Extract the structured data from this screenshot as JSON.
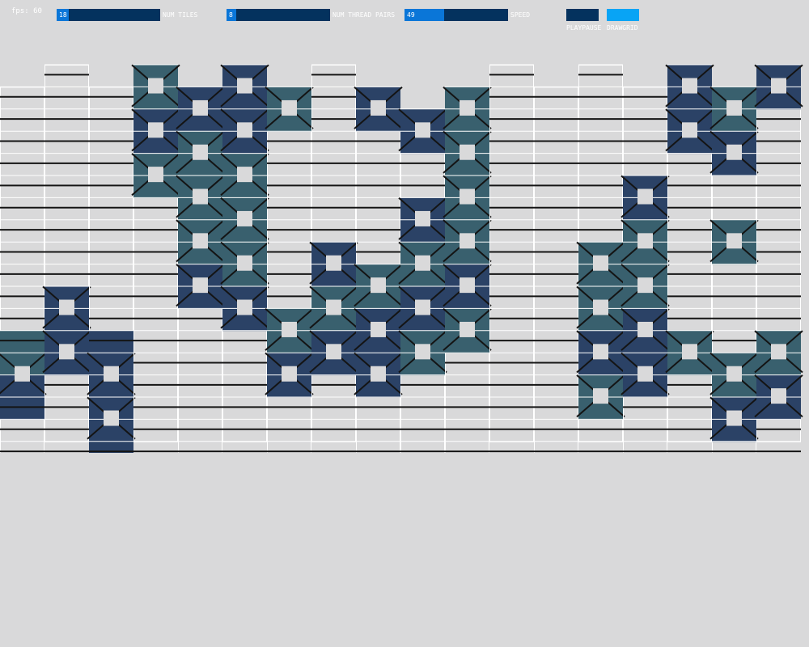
{
  "fps": "fps: 60",
  "sliders": {
    "num_tiles": {
      "value": "18",
      "label": "NUM TILES",
      "fraction": 0.12
    },
    "num_thread_pairs": {
      "value": "8",
      "label": "NUM THREAD PAIRS",
      "fraction": 0.09
    },
    "speed": {
      "value": "49",
      "label": "SPEED",
      "fraction": 0.38
    }
  },
  "buttons": {
    "playpause": {
      "label": "PLAYPAUSE",
      "color": "#04325e"
    },
    "drawgrid": {
      "label": "DRAWGRID",
      "color": "#08a4f5"
    }
  },
  "colors": {
    "background": "#d9d9da",
    "tile_dark": "#2b4266",
    "tile_teal": "#39606e",
    "thread": "#141414",
    "grid_line": "#ffffff"
  },
  "columns": [
    {
      "offset": 1,
      "tiles": [
        {
          "pos": 11,
          "shade": "teal"
        },
        {
          "pos": 12,
          "shade": "teal"
        },
        {
          "pos": 13,
          "shade": "dark"
        },
        {
          "pos": 14,
          "shade": "dark"
        }
      ]
    },
    {
      "offset": 0,
      "tiles": [
        {
          "pos": 10,
          "shade": "dark"
        },
        {
          "pos": 11,
          "shade": "dark"
        },
        {
          "pos": 12,
          "shade": "dark"
        },
        {
          "pos": 13,
          "shade": "dark"
        }
      ]
    },
    {
      "offset": 1,
      "tiles": [
        {
          "pos": 11,
          "shade": "dark"
        },
        {
          "pos": 12,
          "shade": "dark"
        },
        {
          "pos": 13,
          "shade": "dark"
        },
        {
          "pos": 14,
          "shade": "dark"
        },
        {
          "pos": 15,
          "shade": "dark"
        },
        {
          "pos": 16,
          "shade": "dark"
        }
      ]
    },
    {
      "offset": 0,
      "tiles": [
        {
          "pos": 0,
          "shade": "teal"
        },
        {
          "pos": 1,
          "shade": "teal"
        },
        {
          "pos": 2,
          "shade": "dark"
        },
        {
          "pos": 3,
          "shade": "dark"
        },
        {
          "pos": 4,
          "shade": "teal"
        },
        {
          "pos": 5,
          "shade": "teal"
        }
      ]
    },
    {
      "offset": 1,
      "tiles": [
        {
          "pos": 0,
          "shade": "dark"
        },
        {
          "pos": 1,
          "shade": "dark"
        },
        {
          "pos": 2,
          "shade": "teal"
        },
        {
          "pos": 3,
          "shade": "teal"
        },
        {
          "pos": 4,
          "shade": "teal"
        },
        {
          "pos": 5,
          "shade": "teal"
        },
        {
          "pos": 6,
          "shade": "teal"
        },
        {
          "pos": 7,
          "shade": "teal"
        },
        {
          "pos": 8,
          "shade": "dark"
        },
        {
          "pos": 9,
          "shade": "dark"
        }
      ]
    },
    {
      "offset": 0,
      "tiles": [
        {
          "pos": 0,
          "shade": "dark"
        },
        {
          "pos": 1,
          "shade": "dark"
        },
        {
          "pos": 2,
          "shade": "dark"
        },
        {
          "pos": 3,
          "shade": "dark"
        },
        {
          "pos": 4,
          "shade": "teal"
        },
        {
          "pos": 5,
          "shade": "teal"
        },
        {
          "pos": 6,
          "shade": "teal"
        },
        {
          "pos": 7,
          "shade": "teal"
        },
        {
          "pos": 8,
          "shade": "teal"
        },
        {
          "pos": 9,
          "shade": "teal"
        },
        {
          "pos": 10,
          "shade": "dark"
        },
        {
          "pos": 11,
          "shade": "dark"
        }
      ]
    },
    {
      "offset": 1,
      "tiles": [
        {
          "pos": 0,
          "shade": "teal"
        },
        {
          "pos": 1,
          "shade": "teal"
        },
        {
          "pos": 10,
          "shade": "teal"
        },
        {
          "pos": 11,
          "shade": "teal"
        },
        {
          "pos": 12,
          "shade": "dark"
        },
        {
          "pos": 13,
          "shade": "dark"
        }
      ]
    },
    {
      "offset": 0,
      "tiles": [
        {
          "pos": 8,
          "shade": "dark"
        },
        {
          "pos": 9,
          "shade": "dark"
        },
        {
          "pos": 10,
          "shade": "teal"
        },
        {
          "pos": 11,
          "shade": "teal"
        },
        {
          "pos": 12,
          "shade": "dark"
        },
        {
          "pos": 13,
          "shade": "dark"
        }
      ]
    },
    {
      "offset": 1,
      "tiles": [
        {
          "pos": 0,
          "shade": "dark"
        },
        {
          "pos": 1,
          "shade": "dark"
        },
        {
          "pos": 8,
          "shade": "teal"
        },
        {
          "pos": 9,
          "shade": "teal"
        },
        {
          "pos": 10,
          "shade": "dark"
        },
        {
          "pos": 11,
          "shade": "dark"
        },
        {
          "pos": 12,
          "shade": "dark"
        },
        {
          "pos": 13,
          "shade": "dark"
        }
      ]
    },
    {
      "offset": 2,
      "tiles": [
        {
          "pos": 0,
          "shade": "dark"
        },
        {
          "pos": 1,
          "shade": "dark"
        },
        {
          "pos": 4,
          "shade": "dark"
        },
        {
          "pos": 5,
          "shade": "dark"
        },
        {
          "pos": 6,
          "shade": "teal"
        },
        {
          "pos": 7,
          "shade": "teal"
        },
        {
          "pos": 8,
          "shade": "dark"
        },
        {
          "pos": 9,
          "shade": "dark"
        },
        {
          "pos": 10,
          "shade": "teal"
        },
        {
          "pos": 11,
          "shade": "teal"
        }
      ]
    },
    {
      "offset": 1,
      "tiles": [
        {
          "pos": 0,
          "shade": "teal"
        },
        {
          "pos": 1,
          "shade": "teal"
        },
        {
          "pos": 2,
          "shade": "teal"
        },
        {
          "pos": 3,
          "shade": "teal"
        },
        {
          "pos": 4,
          "shade": "teal"
        },
        {
          "pos": 5,
          "shade": "teal"
        },
        {
          "pos": 6,
          "shade": "teal"
        },
        {
          "pos": 7,
          "shade": "teal"
        },
        {
          "pos": 8,
          "shade": "dark"
        },
        {
          "pos": 9,
          "shade": "dark"
        },
        {
          "pos": 10,
          "shade": "teal"
        },
        {
          "pos": 11,
          "shade": "teal"
        }
      ]
    },
    {
      "offset": 0,
      "tiles": []
    },
    {
      "offset": 1,
      "tiles": []
    },
    {
      "offset": 0,
      "tiles": [
        {
          "pos": 8,
          "shade": "teal"
        },
        {
          "pos": 9,
          "shade": "teal"
        },
        {
          "pos": 10,
          "shade": "teal"
        },
        {
          "pos": 11,
          "shade": "teal"
        },
        {
          "pos": 12,
          "shade": "dark"
        },
        {
          "pos": 13,
          "shade": "dark"
        },
        {
          "pos": 14,
          "shade": "teal"
        },
        {
          "pos": 15,
          "shade": "teal"
        }
      ]
    },
    {
      "offset": 1,
      "tiles": [
        {
          "pos": 4,
          "shade": "dark"
        },
        {
          "pos": 5,
          "shade": "dark"
        },
        {
          "pos": 6,
          "shade": "teal"
        },
        {
          "pos": 7,
          "shade": "teal"
        },
        {
          "pos": 8,
          "shade": "teal"
        },
        {
          "pos": 9,
          "shade": "teal"
        },
        {
          "pos": 10,
          "shade": "dark"
        },
        {
          "pos": 11,
          "shade": "dark"
        },
        {
          "pos": 12,
          "shade": "dark"
        },
        {
          "pos": 13,
          "shade": "dark"
        }
      ]
    },
    {
      "offset": 0,
      "tiles": [
        {
          "pos": 0,
          "shade": "dark"
        },
        {
          "pos": 1,
          "shade": "dark"
        },
        {
          "pos": 2,
          "shade": "dark"
        },
        {
          "pos": 3,
          "shade": "dark"
        },
        {
          "pos": 12,
          "shade": "teal"
        },
        {
          "pos": 13,
          "shade": "teal"
        }
      ]
    },
    {
      "offset": 1,
      "tiles": [
        {
          "pos": 0,
          "shade": "teal"
        },
        {
          "pos": 1,
          "shade": "teal"
        },
        {
          "pos": 2,
          "shade": "dark"
        },
        {
          "pos": 3,
          "shade": "dark"
        },
        {
          "pos": 6,
          "shade": "teal"
        },
        {
          "pos": 7,
          "shade": "teal"
        },
        {
          "pos": 12,
          "shade": "teal"
        },
        {
          "pos": 13,
          "shade": "teal"
        },
        {
          "pos": 14,
          "shade": "dark"
        },
        {
          "pos": 15,
          "shade": "dark"
        }
      ]
    },
    {
      "offset": 0,
      "tiles": [
        {
          "pos": 0,
          "shade": "dark"
        },
        {
          "pos": 1,
          "shade": "dark"
        },
        {
          "pos": 12,
          "shade": "teal"
        },
        {
          "pos": 13,
          "shade": "teal"
        },
        {
          "pos": 14,
          "shade": "dark"
        },
        {
          "pos": 15,
          "shade": "dark"
        }
      ]
    }
  ]
}
